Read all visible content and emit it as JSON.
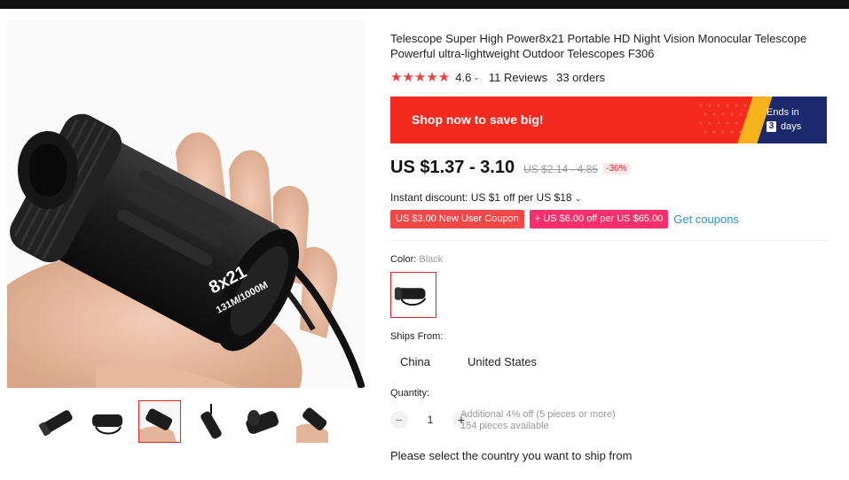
{
  "product": {
    "title": "Telescope Super High Power8x21 Portable HD Night Vision Monocular Telescope Powerful ultra-lightweight Outdoor Telescopes F306",
    "stars": "★★★★★",
    "rating": "4.6",
    "reviews": "11 Reviews",
    "orders": "33 orders"
  },
  "banner": {
    "text": "Shop now to save big!",
    "ends_label": "Ends in",
    "days_num": "3",
    "days_label": "days"
  },
  "price": {
    "current": "US $1.37 - 3.10",
    "original": "US $2.14 - 4.85",
    "discount": "-36%"
  },
  "instant_discount": "Instant discount: US $1 off per US $18",
  "coupons": {
    "c1": "US $3.00 New User Coupon",
    "c2": "+ US $6.00 off per US $65.00",
    "link": "Get coupons"
  },
  "color": {
    "label": "Color:",
    "value": "Black"
  },
  "ships_from": {
    "label": "Ships From:",
    "options": [
      "China",
      "United States"
    ]
  },
  "quantity": {
    "label": "Quantity:",
    "minus": "−",
    "value": "1",
    "plus": "+",
    "info1": "Additional 4% off (5 pieces or more)",
    "info2": "154 pieces available"
  },
  "ship_message": "Please select the country you want to ship from",
  "image_text": {
    "line1": "8x21",
    "line2": "131M/1000M"
  },
  "colors": {
    "accent": "#f52a1e",
    "star": "#f03f3f",
    "navy": "#1a2a6c",
    "link": "#2e90c4"
  }
}
